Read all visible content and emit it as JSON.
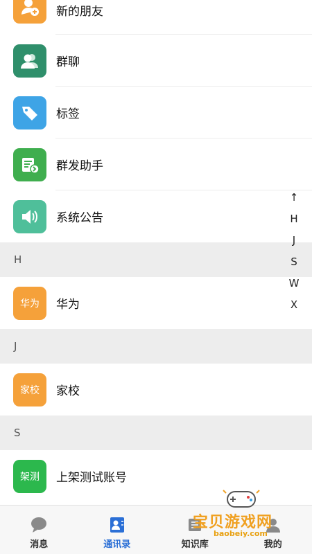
{
  "contacts": {
    "system_items": [
      {
        "label": "新的朋友",
        "icon": "add-friend-icon",
        "color": "#f5a13a"
      },
      {
        "label": "群聊",
        "icon": "group-chat-icon",
        "color": "#2f8f6b"
      },
      {
        "label": "标签",
        "icon": "tag-icon",
        "color": "#3ea4e6"
      },
      {
        "label": "群发助手",
        "icon": "broadcast-icon",
        "color": "#3fae4e"
      },
      {
        "label": "系统公告",
        "icon": "speaker-icon",
        "color": "#4fbf9a"
      }
    ],
    "sections": [
      {
        "letter": "H",
        "items": [
          {
            "label": "华为",
            "avatar_text": "华为",
            "color": "#f5a13a"
          }
        ]
      },
      {
        "letter": "J",
        "items": [
          {
            "label": "家校",
            "avatar_text": "家校",
            "color": "#f5a13a"
          }
        ]
      },
      {
        "letter": "S",
        "items": [
          {
            "label": "上架测试账号",
            "avatar_text": "架测",
            "color": "#2cb84d"
          }
        ]
      }
    ]
  },
  "index_bar": [
    "↑",
    "H",
    "J",
    "S",
    "W",
    "X"
  ],
  "tabbar": {
    "tabs": [
      {
        "label": "消息",
        "icon": "chat-bubble-icon",
        "active": false
      },
      {
        "label": "通讯录",
        "icon": "contacts-icon",
        "active": true
      },
      {
        "label": "知识库",
        "icon": "knowledge-icon",
        "active": false
      },
      {
        "label": "我的",
        "icon": "profile-icon",
        "active": false
      }
    ],
    "active_color": "#2b6fd6"
  },
  "watermark": {
    "title": "宝贝游戏网",
    "domain": "baobeiy.com"
  }
}
